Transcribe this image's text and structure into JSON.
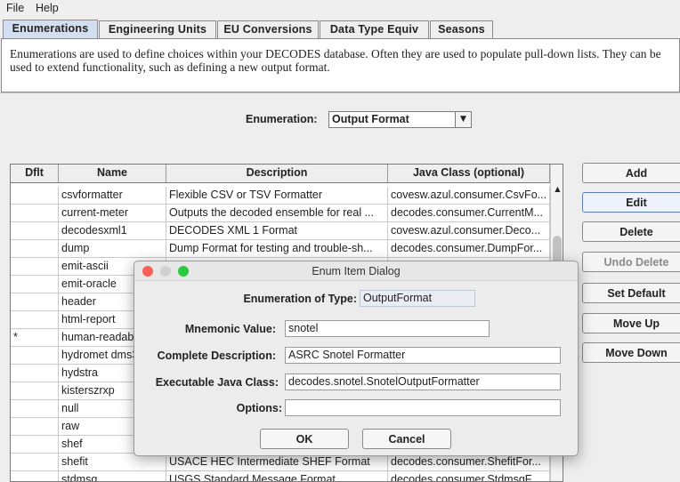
{
  "menu": [
    "File",
    "Help"
  ],
  "tabs": [
    "Enumerations",
    "Engineering Units",
    "EU Conversions",
    "Data Type Equiv",
    "Seasons"
  ],
  "info_text": "Enumerations are used to define choices within your DECODES database. Often they are used to populate pull-down lists. They can be used to extend functionality, such as defining a new output format.",
  "enumeration": {
    "label": "Enumeration:",
    "selected": "Output Format"
  },
  "table": {
    "columns": [
      "Dflt",
      "Name",
      "Description",
      "Java Class (optional)"
    ],
    "rows": [
      {
        "dflt": "",
        "name": "csvformatter",
        "desc": "Flexible CSV or TSV Formatter",
        "cls": "covesw.azul.consumer.CsvFo..."
      },
      {
        "dflt": "",
        "name": "current-meter",
        "desc": "Outputs the decoded ensemble for real ...",
        "cls": "decodes.consumer.CurrentM..."
      },
      {
        "dflt": "",
        "name": "decodesxml1",
        "desc": "DECODES XML 1 Format",
        "cls": "covesw.azul.consumer.Deco..."
      },
      {
        "dflt": "",
        "name": "dump",
        "desc": "Dump Format for testing and trouble-sh...",
        "cls": "decodes.consumer.DumpFor..."
      },
      {
        "dflt": "",
        "name": "emit-ascii",
        "desc": "",
        "cls": ""
      },
      {
        "dflt": "",
        "name": "emit-oracle",
        "desc": "",
        "cls": ""
      },
      {
        "dflt": "",
        "name": "header",
        "desc": "",
        "cls": ""
      },
      {
        "dflt": "",
        "name": "html-report",
        "desc": "",
        "cls": ""
      },
      {
        "dflt": "*",
        "name": "human-readable",
        "desc": "",
        "cls": ""
      },
      {
        "dflt": "",
        "name": "hydromet dms3",
        "desc": "",
        "cls": ""
      },
      {
        "dflt": "",
        "name": "hydstra",
        "desc": "",
        "cls": ""
      },
      {
        "dflt": "",
        "name": "kisterszrxp",
        "desc": "",
        "cls": ""
      },
      {
        "dflt": "",
        "name": "null",
        "desc": "",
        "cls": ""
      },
      {
        "dflt": "",
        "name": "raw",
        "desc": "",
        "cls": ""
      },
      {
        "dflt": "",
        "name": "shef",
        "desc": "",
        "cls": ""
      },
      {
        "dflt": "",
        "name": "shefit",
        "desc": "USACE HEC Intermediate SHEF Format",
        "cls": "decodes.consumer.ShefitFor..."
      },
      {
        "dflt": "",
        "name": "stdmsg",
        "desc": "USGS Standard Message Format",
        "cls": "decodes.consumer.StdmsgF..."
      }
    ]
  },
  "side_buttons": [
    "Add",
    "Edit",
    "Delete",
    "Undo Delete",
    "Set Default",
    "Move Up",
    "Move Down"
  ],
  "dialog": {
    "title": "Enum Item Dialog",
    "enum_type_label": "Enumeration of Type:",
    "enum_type_value": "OutputFormat",
    "mnemonic_label": "Mnemonic Value:",
    "mnemonic_value": "snotel",
    "description_label": "Complete Description:",
    "description_value": "ASRC Snotel Formatter",
    "java_class_label": "Executable Java Class:",
    "java_class_value": "decodes.snotel.SnotelOutputFormatter",
    "options_label": "Options:",
    "options_value": "",
    "ok_label": "OK",
    "cancel_label": "Cancel"
  },
  "colors": {
    "active_tab": "#d3dff0",
    "close": "#fc5f57",
    "minimize": "#d0d0d0",
    "zoom": "#2ac940"
  }
}
